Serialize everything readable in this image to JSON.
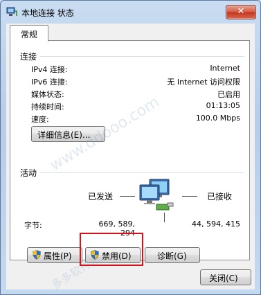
{
  "window": {
    "title": "本地连接 状态",
    "close_glyph": "✕",
    "tab_label": "常规"
  },
  "connection": {
    "section_title": "连接",
    "rows": [
      {
        "label": "IPv4 连接:",
        "value": "Internet"
      },
      {
        "label": "IPv6 连接:",
        "value": "无 Internet 访问权限"
      },
      {
        "label": "媒体状态:",
        "value": "已启用"
      },
      {
        "label": "持续时间:",
        "value": "01:13:05"
      },
      {
        "label": "速度:",
        "value": "100.0 Mbps"
      }
    ],
    "details_button": "详细信息(E)..."
  },
  "activity": {
    "section_title": "活动",
    "sent_label": "已发送",
    "received_label": "已接收",
    "bytes_label": "字节:",
    "bytes_sent": "669, 589, 294",
    "bytes_received": "44, 594, 415",
    "network_icon": "network-computers-icon"
  },
  "buttons": {
    "properties": "属性(P)",
    "disable": "禁用(D)",
    "diagnose": "诊断(G)",
    "close": "关闭(C)"
  },
  "watermark": {
    "text": "www.ddooo.com",
    "site_name": "多多软件站"
  },
  "colors": {
    "highlight_box": "#d4141a",
    "close_button": "#c1361f",
    "title_bar": "#c9dcf1"
  }
}
